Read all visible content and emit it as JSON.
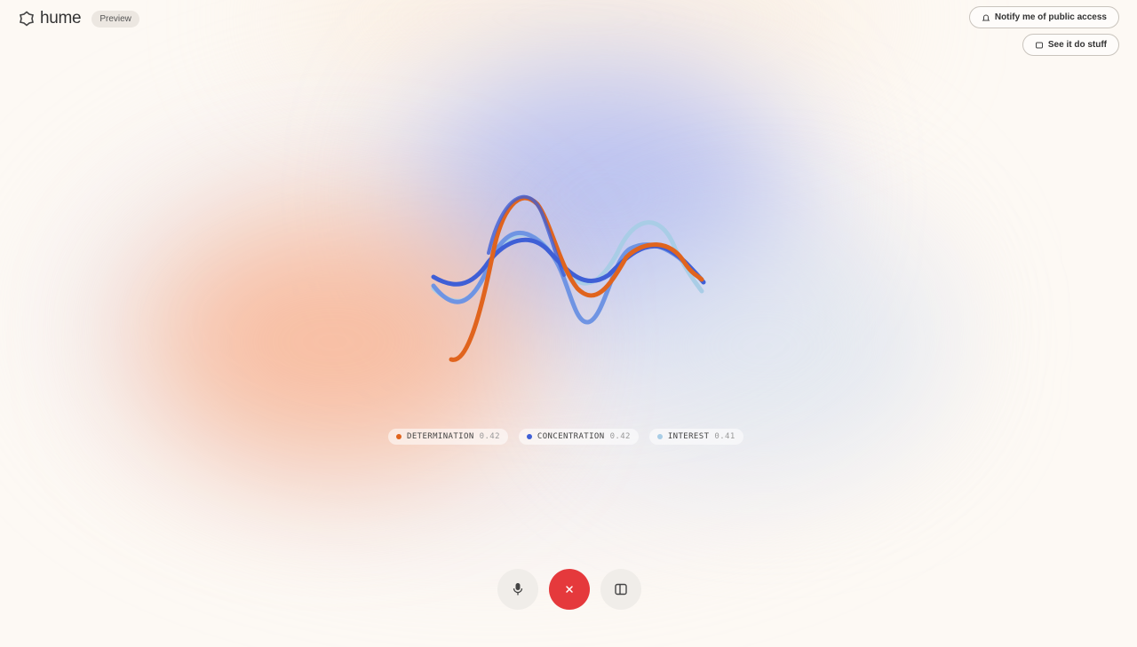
{
  "header": {
    "brand": "hume",
    "badge": "Preview"
  },
  "actions": {
    "notify": "Notify me of public access",
    "see": "See it do stuff"
  },
  "emotions": [
    {
      "label": "DETERMINATION",
      "value": "0.42",
      "color": "#e0641e"
    },
    {
      "label": "CONCENTRATION",
      "value": "0.42",
      "color": "#3f5fd6"
    },
    {
      "label": "INTEREST",
      "value": "0.41",
      "color": "#a9cde6"
    }
  ],
  "controls": {
    "mic": "microphone",
    "end": "end-call",
    "panel": "toggle-panel"
  },
  "colors": {
    "end_call": "#e5393c",
    "determination": "#e0641e",
    "concentration": "#3f5fd6",
    "interest": "#a9cde6"
  }
}
